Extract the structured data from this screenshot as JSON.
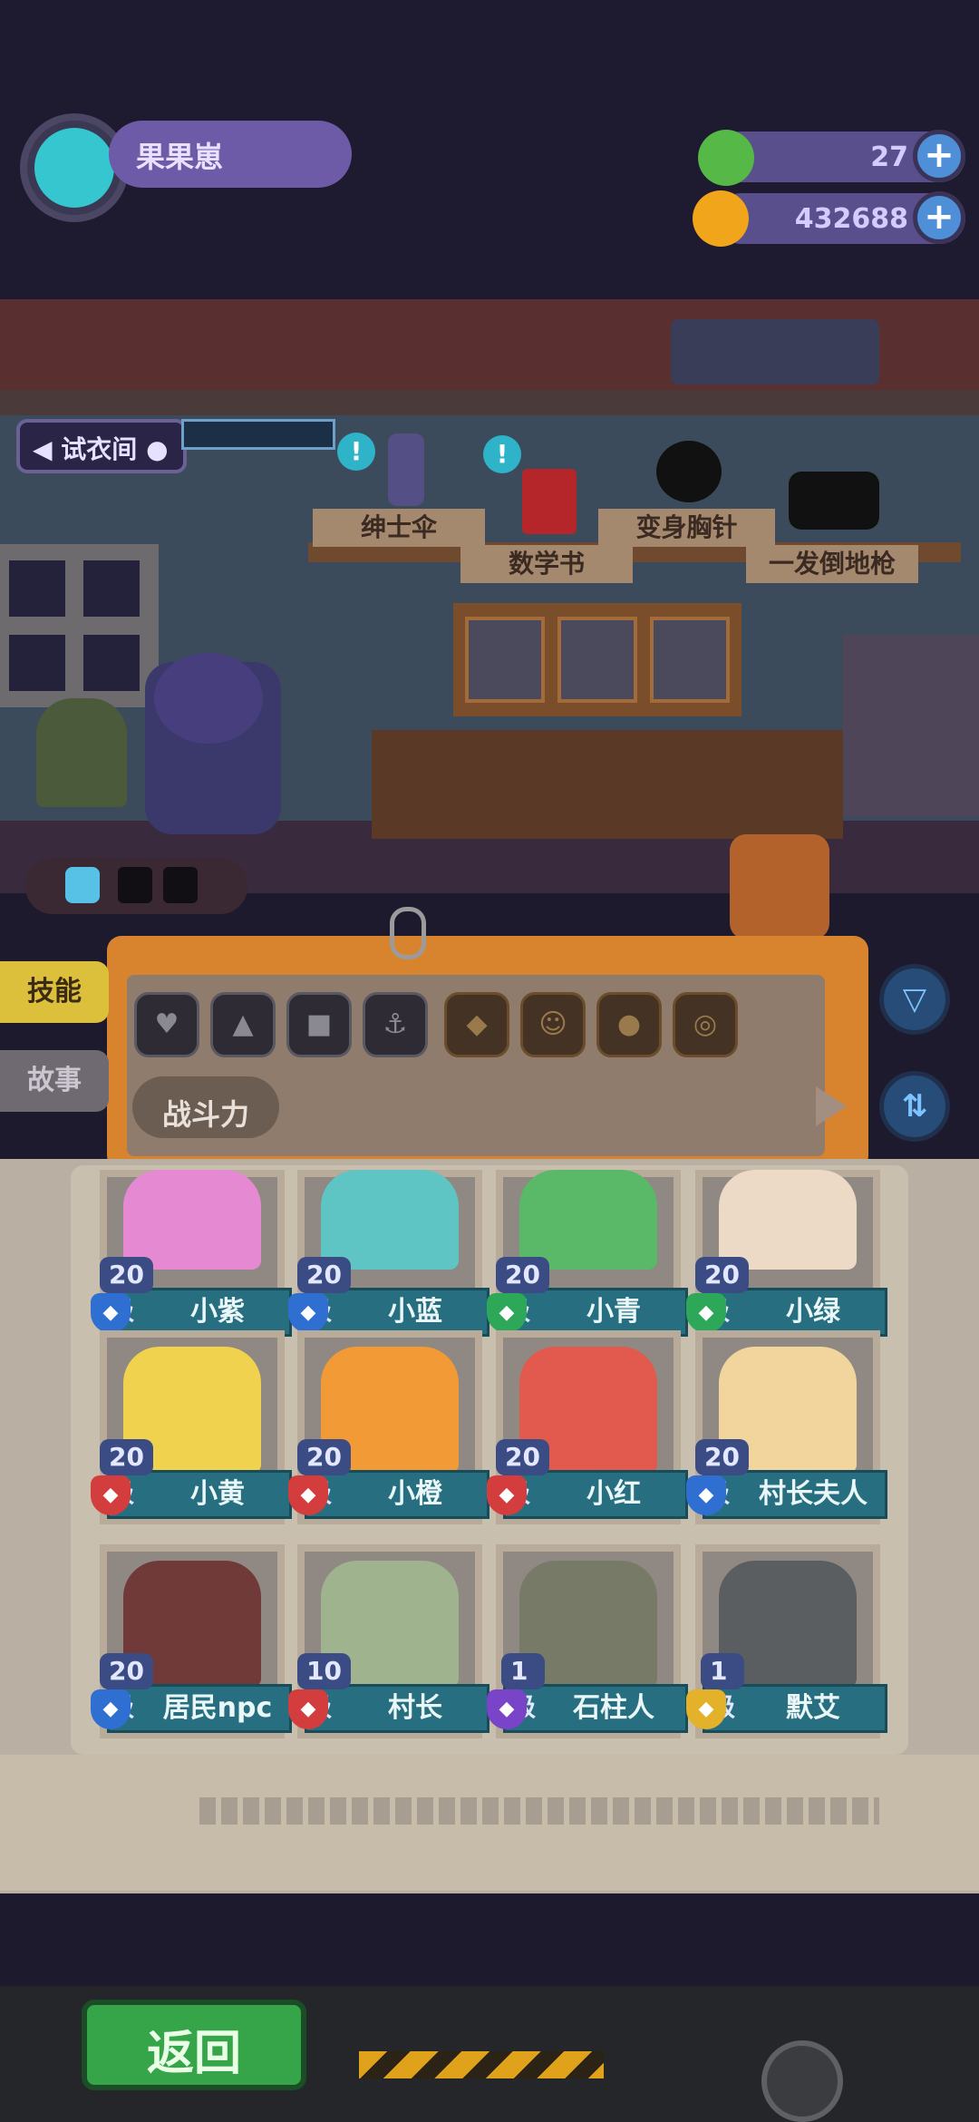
{
  "player": {
    "name": "果果崽"
  },
  "resources": [
    {
      "icon": "donut-coin-icon",
      "value": "27",
      "color": "#55b847"
    },
    {
      "icon": "planet-coin-icon",
      "value": "432688",
      "color": "#f0a51a"
    }
  ],
  "room": {
    "fitting_room_label": "试衣间",
    "shelf_items": [
      "绅士伞",
      "数学书",
      "变身胸针",
      "一发倒地枪"
    ]
  },
  "side_tabs": [
    "技能",
    "故事"
  ],
  "filter": {
    "sort_label": "战斗力"
  },
  "characters": [
    {
      "level": "20级",
      "name": "小紫",
      "class_color": "#2f6fd1",
      "portrait_color": "#e58ad2"
    },
    {
      "level": "20级",
      "name": "小蓝",
      "class_color": "#2f6fd1",
      "portrait_color": "#5ec5c4"
    },
    {
      "level": "20级",
      "name": "小青",
      "class_color": "#2da859",
      "portrait_color": "#59b968"
    },
    {
      "level": "20级",
      "name": "小绿",
      "class_color": "#2da859",
      "portrait_color": "#ecd9c6"
    },
    {
      "level": "20级",
      "name": "小黄",
      "class_color": "#d43d3d",
      "portrait_color": "#f1d24e"
    },
    {
      "level": "20级",
      "name": "小橙",
      "class_color": "#d43d3d",
      "portrait_color": "#f29a36"
    },
    {
      "level": "20级",
      "name": "小红",
      "class_color": "#d43d3d",
      "portrait_color": "#e2594d"
    },
    {
      "level": "20级",
      "name": "村长夫人",
      "class_color": "#2f6fd1",
      "portrait_color": "#f1d59c"
    },
    {
      "level": "20级",
      "name": "居民npc",
      "class_color": "#2f6fd1",
      "portrait_color": "#6f3a38"
    },
    {
      "level": "10级",
      "name": "村长",
      "class_color": "#d43d3d",
      "portrait_color": "#9fb38e"
    },
    {
      "level": "1级",
      "name": "石柱人",
      "class_color": "#7a44c9",
      "portrait_color": "#787a68"
    },
    {
      "level": "1级",
      "name": "默艾",
      "class_color": "#e3b22a",
      "portrait_color": "#5b5e60"
    }
  ],
  "back_label": "返回"
}
